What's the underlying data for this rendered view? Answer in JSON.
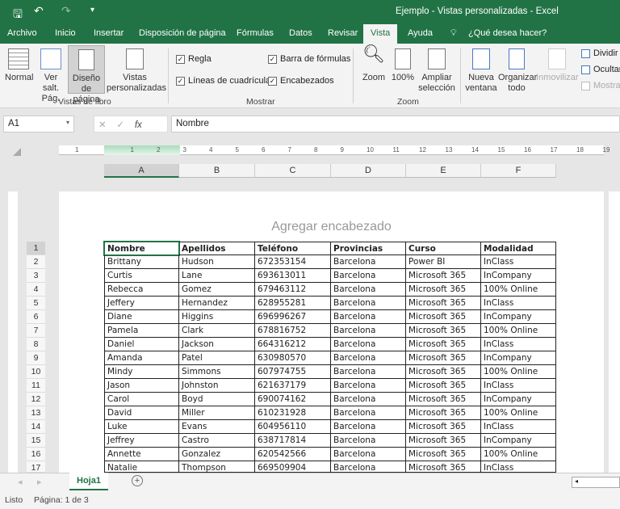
{
  "title": "Ejemplo - Vistas personalizadas  -  Excel",
  "tabs": [
    "Archivo",
    "Inicio",
    "Insertar",
    "Disposición de página",
    "Fórmulas",
    "Datos",
    "Revisar",
    "Vista",
    "Ayuda"
  ],
  "active_tab": "Vista",
  "tell_me": "¿Qué desea hacer?",
  "ribbon": {
    "vistas": {
      "normal": "Normal",
      "ver_salt": "Ver salt. Pág.",
      "diseno": "Diseño de página",
      "vistas_pers": "Vistas personalizadas",
      "group": "Vistas de libro"
    },
    "mostrar": {
      "regla": "Regla",
      "lineas": "Líneas de cuadrícula",
      "barra": "Barra de fórmulas",
      "encabezados": "Encabezados",
      "group": "Mostrar"
    },
    "zoom": {
      "zoom": "Zoom",
      "cien": "100%",
      "ampliar": "Ampliar selección",
      "group": "Zoom"
    },
    "ventana": {
      "nueva": "Nueva ventana",
      "organizar": "Organizar todo",
      "inmovilizar": "Inmovilizar",
      "dividir": "Dividir",
      "ocultar": "Ocultar",
      "mostrar": "Mostrar"
    }
  },
  "name_box": "A1",
  "formula": "Nombre",
  "fx": "fx",
  "ruler_ticks": [
    "1",
    "1",
    "2",
    "3",
    "4",
    "5",
    "6",
    "7",
    "8",
    "9",
    "10",
    "11",
    "12",
    "13",
    "14",
    "15",
    "16",
    "17",
    "18",
    "19"
  ],
  "columns": [
    "A",
    "B",
    "C",
    "D",
    "E",
    "F"
  ],
  "header_placeholder": "Agregar encabezado",
  "table": {
    "headers": [
      "Nombre",
      "Apellidos",
      "Teléfono",
      "Provincias",
      "Curso",
      "Modalidad"
    ],
    "rows": [
      [
        "Brittany",
        "Hudson",
        "672353154",
        "Barcelona",
        "Power BI",
        "InClass"
      ],
      [
        "Curtis",
        "Lane",
        "693613011",
        "Barcelona",
        "Microsoft 365",
        "InCompany"
      ],
      [
        "Rebecca",
        "Gomez",
        "679463112",
        "Barcelona",
        "Microsoft 365",
        "100% Online"
      ],
      [
        "Jeffery",
        "Hernandez",
        "628955281",
        "Barcelona",
        "Microsoft 365",
        "InClass"
      ],
      [
        "Diane",
        "Higgins",
        "696996267",
        "Barcelona",
        "Microsoft 365",
        "InCompany"
      ],
      [
        "Pamela",
        "Clark",
        "678816752",
        "Barcelona",
        "Microsoft 365",
        "100% Online"
      ],
      [
        "Daniel",
        "Jackson",
        "664316212",
        "Barcelona",
        "Microsoft 365",
        "InClass"
      ],
      [
        "Amanda",
        "Patel",
        "630980570",
        "Barcelona",
        "Microsoft 365",
        "InCompany"
      ],
      [
        "Mindy",
        "Simmons",
        "607974755",
        "Barcelona",
        "Microsoft 365",
        "100% Online"
      ],
      [
        "Jason",
        "Johnston",
        "621637179",
        "Barcelona",
        "Microsoft 365",
        "InClass"
      ],
      [
        "Carol",
        "Boyd",
        "690074162",
        "Barcelona",
        "Microsoft 365",
        "InCompany"
      ],
      [
        "David",
        "Miller",
        "610231928",
        "Barcelona",
        "Microsoft 365",
        "100% Online"
      ],
      [
        "Luke",
        "Evans",
        "604956110",
        "Barcelona",
        "Microsoft 365",
        "InClass"
      ],
      [
        "Jeffrey",
        "Castro",
        "638717814",
        "Barcelona",
        "Microsoft 365",
        "InCompany"
      ],
      [
        "Annette",
        "Gonzalez",
        "620542566",
        "Barcelona",
        "Microsoft 365",
        "100% Online"
      ],
      [
        "Natalie",
        "Thompson",
        "669509904",
        "Barcelona",
        "Microsoft 365",
        "InClass"
      ]
    ]
  },
  "sheet_tab": "Hoja1",
  "status": {
    "ready": "Listo",
    "page": "Página: 1 de 3"
  },
  "colors": {
    "accent": "#217346"
  }
}
